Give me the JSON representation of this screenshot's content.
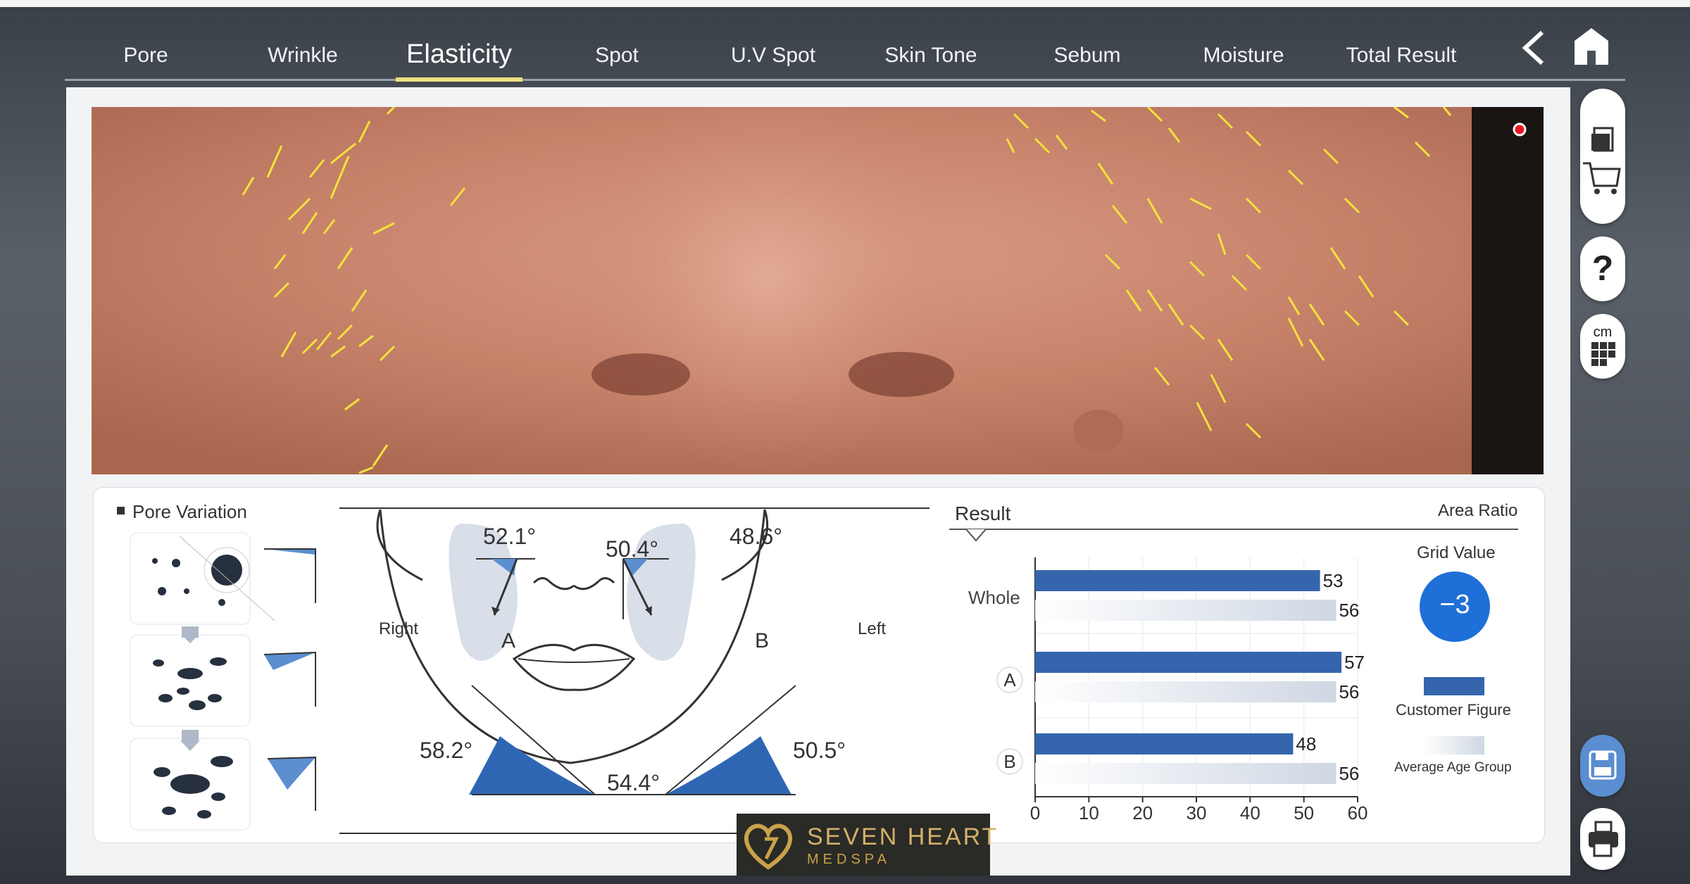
{
  "nav": {
    "tabs": [
      {
        "label": "Pore"
      },
      {
        "label": "Wrinkle"
      },
      {
        "label": "Elasticity"
      },
      {
        "label": "Spot"
      },
      {
        "label": "U.V Spot"
      },
      {
        "label": "Skin Tone"
      },
      {
        "label": "Sebum"
      },
      {
        "label": "Moisture"
      },
      {
        "label": "Total Result"
      }
    ],
    "active_tab": "Elasticity"
  },
  "pore_variation": {
    "title": "Pore Variation"
  },
  "face": {
    "angle_a": "52.1°",
    "angle_center": "50.4°",
    "angle_b": "48.6°",
    "label_a": "A",
    "label_b": "B",
    "right": "Right",
    "left": "Left",
    "jaw_right": "58.2°",
    "jaw_center": "54.4°",
    "jaw_left": "50.5°"
  },
  "result": {
    "title": "Result",
    "area_ratio": "Area Ratio",
    "grid_value_label": "Grid Value",
    "grid_value": "−3",
    "legend_customer": "Customer Figure",
    "legend_average": "Average Age Group"
  },
  "chart_data": {
    "type": "bar",
    "orientation": "horizontal",
    "categories": [
      "Whole",
      "A",
      "B"
    ],
    "series": [
      {
        "name": "Customer Figure",
        "values": [
          53,
          57,
          48
        ]
      },
      {
        "name": "Average Age Group",
        "values": [
          56,
          56,
          56
        ]
      }
    ],
    "xlim": [
      0,
      60
    ],
    "xticks": [
      0,
      10,
      20,
      30,
      40,
      50,
      60
    ],
    "colors": {
      "customer": "#3566ad",
      "average": "#dde3ec"
    }
  },
  "branding": {
    "name": "SEVEN HEART",
    "sub": "MEDSPA"
  },
  "colors": {
    "accent": "#2f66b3",
    "badge": "#1f6fd8",
    "underline": "#f0e080"
  }
}
